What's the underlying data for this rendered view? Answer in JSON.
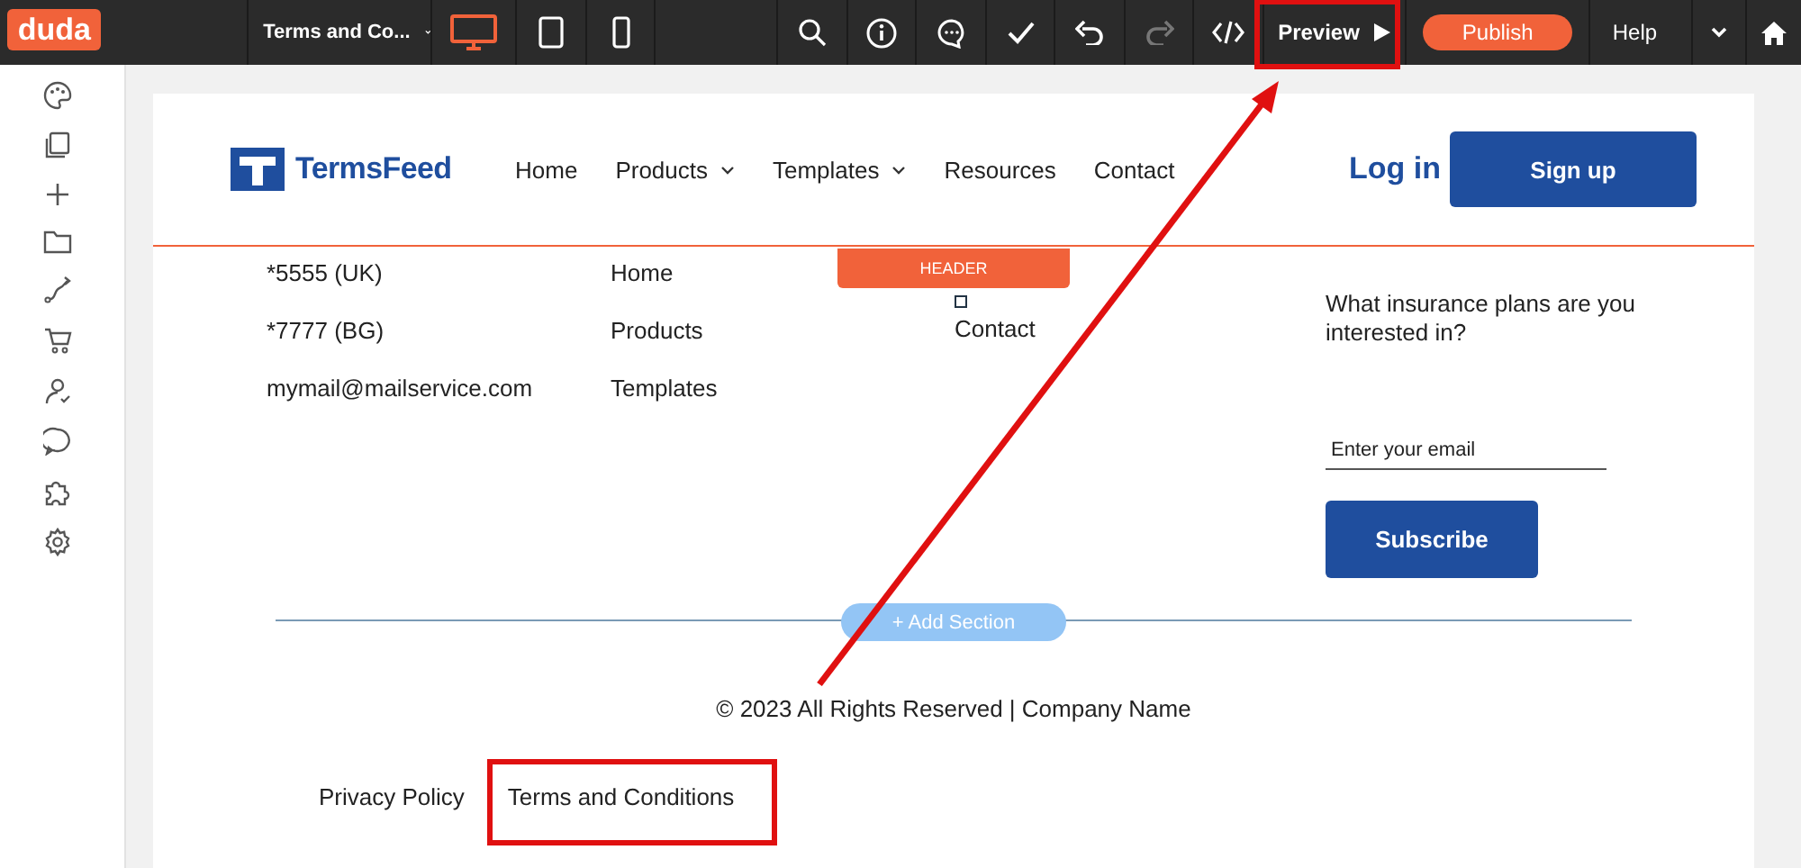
{
  "toolbar": {
    "logo": "duda",
    "page_selector": "Terms and Co...",
    "devices": [
      {
        "kind": "desktop",
        "selected": true
      },
      {
        "kind": "tablet",
        "selected": false
      },
      {
        "kind": "mobile",
        "selected": false
      }
    ],
    "tools": [
      {
        "kind": "search",
        "disabled": false
      },
      {
        "kind": "info",
        "disabled": false
      },
      {
        "kind": "comment",
        "disabled": false
      },
      {
        "kind": "check",
        "disabled": false
      },
      {
        "kind": "undo",
        "disabled": false
      },
      {
        "kind": "redo",
        "disabled": true
      },
      {
        "kind": "code",
        "disabled": false
      }
    ],
    "preview": "Preview",
    "publish": "Publish",
    "help": "Help"
  },
  "site_header": {
    "brand": "TermsFeed",
    "nav": [
      {
        "label": "Home",
        "dropdown": false
      },
      {
        "label": "Products",
        "dropdown": true
      },
      {
        "label": "Templates",
        "dropdown": true
      },
      {
        "label": "Resources",
        "dropdown": false
      },
      {
        "label": "Contact",
        "dropdown": false
      }
    ],
    "login": "Log in",
    "signup": "Sign up"
  },
  "editor": {
    "header_tag": "HEADER",
    "add_section": "+ Add Section"
  },
  "footer": {
    "contacts": [
      "*5555 (UK)",
      "*7777 (BG)",
      "mymail@mailservice.com"
    ],
    "links": [
      "Home",
      "Products",
      "Templates"
    ],
    "links_2": [
      "Contact"
    ],
    "newsletter": {
      "question": "What insurance plans are you interested in?",
      "email_placeholder": "Enter your email",
      "button": "Subscribe"
    },
    "copyright": "© 2023 All Rights Reserved | Company Name",
    "bottom_links": [
      "Privacy Policy",
      "Terms and Conditions"
    ]
  }
}
